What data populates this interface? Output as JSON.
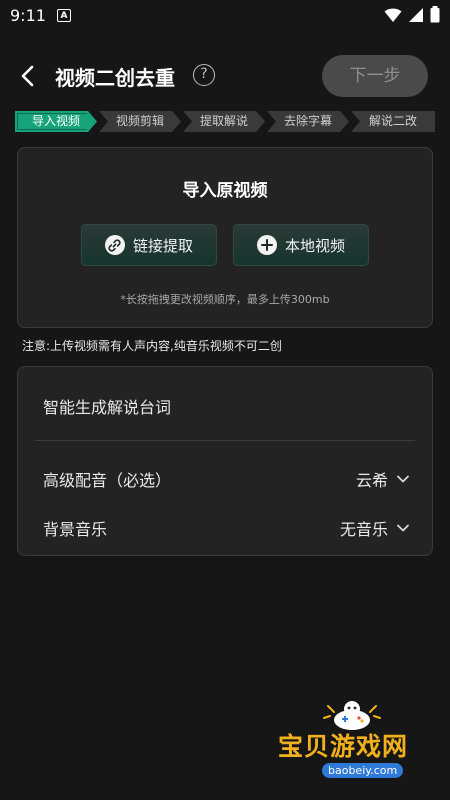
{
  "status_bar": {
    "time": "9:11",
    "notification_glyph": "A"
  },
  "header": {
    "title": "视频二创去重",
    "help_glyph": "?",
    "next_label": "下一步"
  },
  "steps": [
    {
      "label": "导入视频",
      "active": true
    },
    {
      "label": "视频剪辑",
      "active": false
    },
    {
      "label": "提取解说",
      "active": false
    },
    {
      "label": "去除字幕",
      "active": false
    },
    {
      "label": "解说二改",
      "active": false
    }
  ],
  "import_card": {
    "title": "导入原视频",
    "link_button": "链接提取",
    "local_button": "本地视频",
    "hint": "*长按拖拽更改视频顺序，最多上传300mb"
  },
  "notice": "注意:上传视频需有人声内容,纯音乐视频不可二创",
  "settings": {
    "generate_label": "智能生成解说台词",
    "voice_label": "高级配音（必选）",
    "voice_value": "云希",
    "music_label": "背景音乐",
    "music_value": "无音乐"
  },
  "watermark": {
    "title": "宝贝游戏网",
    "url": "baobeiy.com"
  },
  "colors": {
    "accent": "#16a37a",
    "background": "#161616",
    "card": "#232323"
  }
}
